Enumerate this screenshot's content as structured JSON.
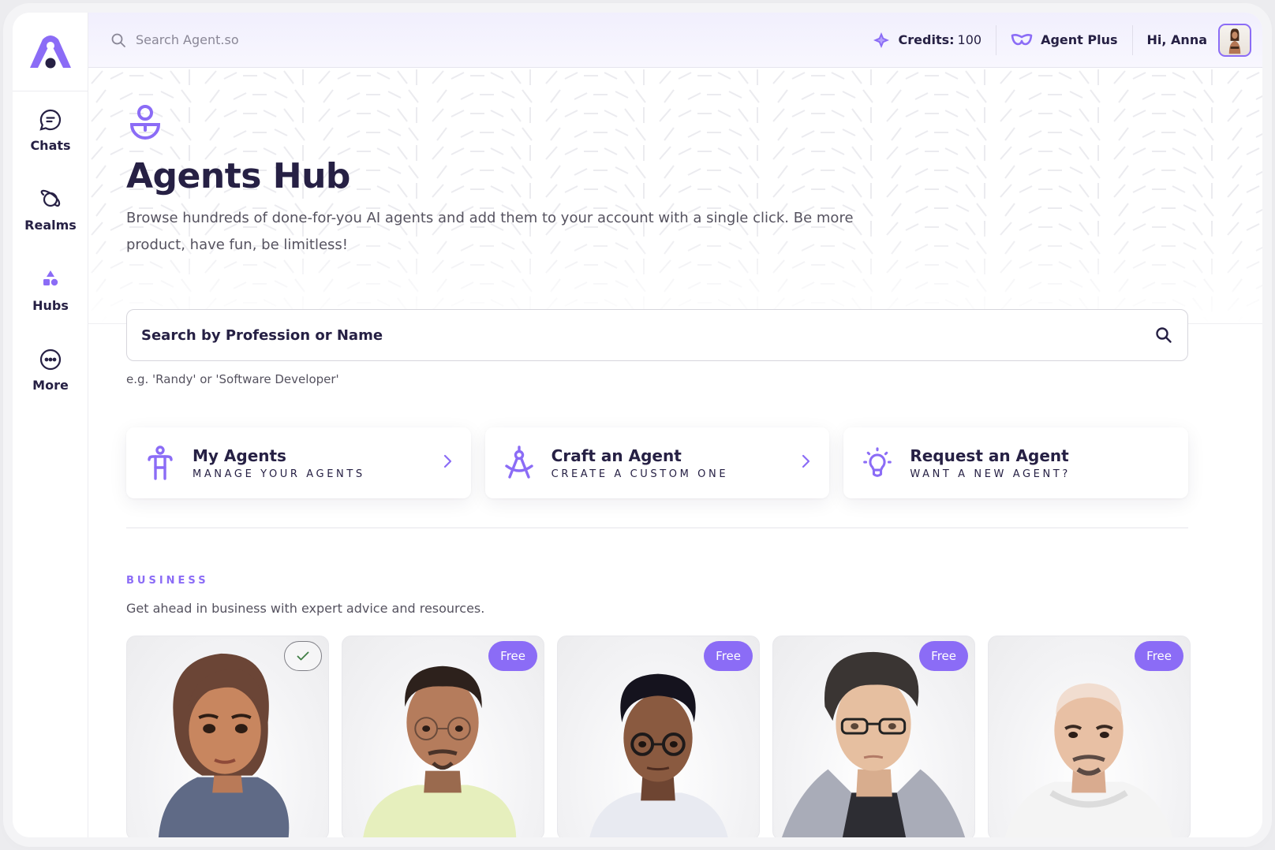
{
  "app": {
    "brand": "Agent.so",
    "brand_color": "#8b6cf6",
    "text_dark": "#262044"
  },
  "sidebar": {
    "logo_icon": "agent-logo-icon",
    "items": [
      {
        "label": "Chats",
        "icon": "chat-bubble-icon",
        "active": false
      },
      {
        "label": "Realms",
        "icon": "planet-icon",
        "active": false
      },
      {
        "label": "Hubs",
        "icon": "shapes-icon",
        "active": true
      },
      {
        "label": "More",
        "icon": "more-dots-icon",
        "active": false
      }
    ]
  },
  "header": {
    "search_placeholder": "Search Agent.so",
    "credits_label": "Credits:",
    "credits_value": "100",
    "plan_label": "Agent Plus",
    "greeting": "Hi, Anna"
  },
  "page": {
    "title": "Agents Hub",
    "description": "Browse hundreds of done-for-you AI agents and add them to your account with a single click. Be more product, have fun, be limitless!",
    "search_placeholder": "Search by Profession or Name",
    "search_hint": "e.g. 'Randy' or 'Software Developer'"
  },
  "actions": [
    {
      "title": "My Agents",
      "subtitle": "MANAGE YOUR AGENTS",
      "icon": "person-icon",
      "has_chevron": true
    },
    {
      "title": "Craft an Agent",
      "subtitle": "CREATE A CUSTOM ONE",
      "icon": "compass-tool-icon",
      "has_chevron": true
    },
    {
      "title": "Request an Agent",
      "subtitle": "WANT A NEW AGENT?",
      "icon": "lightbulb-icon",
      "has_chevron": false
    }
  ],
  "section": {
    "label": "BUSINESS",
    "description": "Get ahead in business with expert advice and resources."
  },
  "agents": [
    {
      "badge": "check",
      "badge_label": "",
      "avatar": "woman-brown-bob-hair"
    },
    {
      "badge": "free",
      "badge_label": "Free",
      "avatar": "man-glasses-goatee"
    },
    {
      "badge": "free",
      "badge_label": "Free",
      "avatar": "man-curly-hair-glasses"
    },
    {
      "badge": "free",
      "badge_label": "Free",
      "avatar": "man-beanie-glasses"
    },
    {
      "badge": "free",
      "badge_label": "Free",
      "avatar": "man-bald-goatee"
    }
  ]
}
